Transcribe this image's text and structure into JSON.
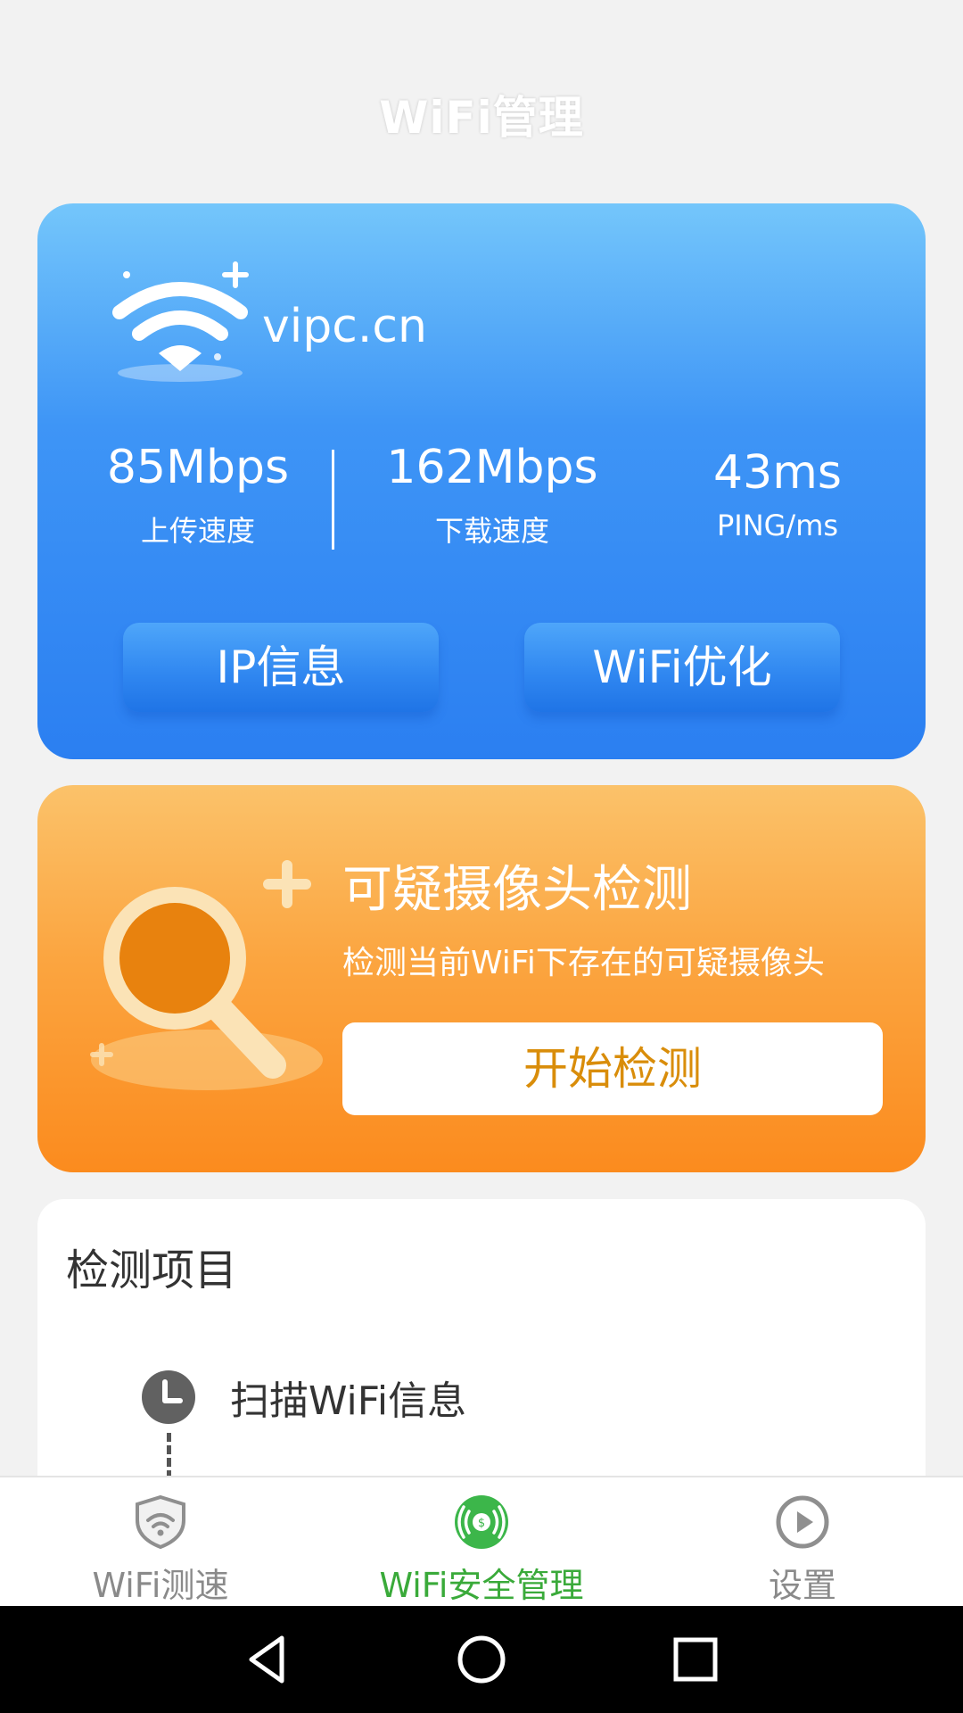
{
  "header": {
    "title": "WiFi管理"
  },
  "wifi_card": {
    "network_name": "vipc.cn",
    "upload": {
      "value": "85Mbps",
      "label": "上传速度"
    },
    "download": {
      "value": "162Mbps",
      "label": "下载速度"
    },
    "ping": {
      "value": "43ms",
      "label": "PING/ms"
    },
    "ip_button": "IP信息",
    "optimize_button": "WiFi优化",
    "icon": "wifi-icon"
  },
  "camera_card": {
    "title": "可疑摄像头检测",
    "description": "检测当前WiFi下存在的可疑摄像头",
    "start_button": "开始检测",
    "icon": "magnifier-icon"
  },
  "detection_items": {
    "title": "检测项目",
    "items": [
      {
        "label": "扫描WiFi信息",
        "icon": "clock-icon"
      }
    ]
  },
  "bottom_nav": {
    "items": [
      {
        "label": "WiFi测速",
        "icon": "wifi-shield-icon",
        "active": false
      },
      {
        "label": "WiFi安全管理",
        "icon": "wifi-security-icon",
        "active": true
      },
      {
        "label": "设置",
        "icon": "play-circle-icon",
        "active": false
      }
    ]
  },
  "system_nav": {
    "back": "back-icon",
    "home": "home-icon",
    "recents": "recents-icon"
  },
  "colors": {
    "blue_card_top": "#74c6fb",
    "blue_card_bottom": "#2b7ff1",
    "orange_card_top": "#fbc26a",
    "orange_card_bottom": "#fb8b1e",
    "start_button_text": "#d98d0a",
    "active_nav": "#3aaa3a",
    "inactive_nav": "#8a8a8a"
  }
}
